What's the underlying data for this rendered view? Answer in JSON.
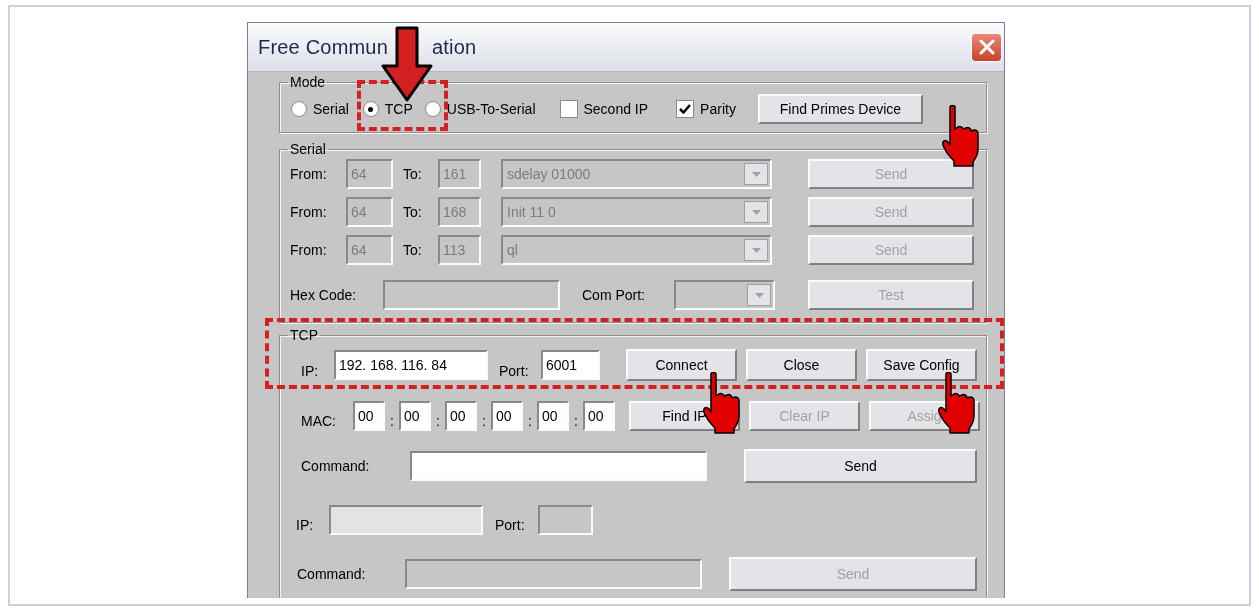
{
  "window": {
    "title_left": "Free Commun",
    "title_right": "ation"
  },
  "mode": {
    "legend": "Mode",
    "options": [
      {
        "label": "Serial",
        "selected": false
      },
      {
        "label": "TCP",
        "selected": true
      },
      {
        "label": "USB-To-Serial",
        "selected": false
      }
    ],
    "checks": [
      {
        "label": "Second IP",
        "checked": false
      },
      {
        "label": "Parity",
        "checked": true
      }
    ],
    "button": "Find Primes Device"
  },
  "serial": {
    "legend": "Serial",
    "disabled": true,
    "rows": [
      {
        "from_label": "From:",
        "from": "64",
        "to_label": "To:",
        "to": "161",
        "command": "sdelay 01000",
        "button": "Send"
      },
      {
        "from_label": "From:",
        "from": "64",
        "to_label": "To:",
        "to": "168",
        "command": "Init 11 0",
        "button": "Send"
      },
      {
        "from_label": "From:",
        "from": "64",
        "to_label": "To:",
        "to": "113",
        "command": "ql",
        "button": "Send"
      }
    ],
    "hex_label": "Hex Code:",
    "com_label": "Com Port:",
    "test_button": "Test"
  },
  "tcp": {
    "legend": "TCP",
    "ip_label": "IP:",
    "ip": "192. 168. 116. 84",
    "port_label": "Port:",
    "port": "6001",
    "buttons": [
      {
        "label": "Connect",
        "disabled": false
      },
      {
        "label": "Close",
        "disabled": false
      },
      {
        "label": "Save Config",
        "disabled": false
      }
    ],
    "mac_label": "MAC:",
    "mac": [
      {
        "value": "00",
        "separator": ":"
      },
      {
        "value": "00",
        "separator": ":"
      },
      {
        "value": "00",
        "separator": ":"
      },
      {
        "value": "00",
        "separator": ":"
      },
      {
        "value": "00",
        "separator": ":"
      },
      {
        "value": "00"
      }
    ],
    "mac_buttons": [
      {
        "label": "Find IP",
        "disabled": false
      },
      {
        "label": "Clear IP",
        "disabled": true
      },
      {
        "label": "Assig",
        "disabled": true
      }
    ],
    "command_label": "Command:",
    "command_button": {
      "label": "Send",
      "disabled": false
    }
  },
  "remote": {
    "disabled": true,
    "ip_label": "IP:",
    "port_label": "Port:",
    "command_label": "Command:",
    "button": {
      "label": "Send",
      "disabled": true
    }
  }
}
